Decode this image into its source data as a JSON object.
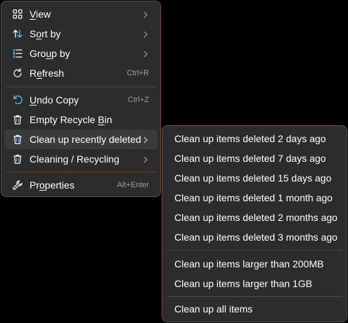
{
  "main_menu": {
    "items": [
      {
        "label": "View",
        "accel_index": 0,
        "shortcut": "",
        "submenu": true,
        "icon": "grid-view-icon"
      },
      {
        "label": "Sort by",
        "accel_index": 1,
        "shortcut": "",
        "submenu": true,
        "icon": "sort-arrows-icon"
      },
      {
        "label": "Group by",
        "accel_index": 3,
        "shortcut": "",
        "submenu": true,
        "icon": "group-list-icon"
      },
      {
        "label": "Refresh",
        "accel_index": 1,
        "shortcut": "Ctrl+R",
        "submenu": false,
        "icon": "refresh-icon"
      },
      {
        "label": "Undo Copy",
        "accel_index": 0,
        "shortcut": "Ctrl+Z",
        "submenu": false,
        "icon": "undo-icon"
      },
      {
        "label": "Empty Recycle Bin",
        "accel_index": 14,
        "shortcut": "",
        "submenu": false,
        "icon": "recycle-bin-icon"
      },
      {
        "label": "Clean up recently deleted",
        "accel_index": -1,
        "shortcut": "",
        "submenu": true,
        "icon": "recycle-bin-icon",
        "highlighted": true
      },
      {
        "label": "Cleaning / Recycling",
        "accel_index": -1,
        "shortcut": "",
        "submenu": true,
        "icon": "recycle-bin-icon"
      },
      {
        "label": "Properties",
        "accel_index": 2,
        "shortcut": "Alt+Enter",
        "submenu": false,
        "icon": "wrench-icon"
      }
    ]
  },
  "sub_menu": {
    "items": [
      {
        "label": "Clean up items deleted 2 days ago"
      },
      {
        "label": "Clean up items deleted 7 days ago"
      },
      {
        "label": "Clean up items deleted 15 days ago"
      },
      {
        "label": "Clean up items deleted 1 month ago"
      },
      {
        "label": "Clean up items deleted 2 months ago"
      },
      {
        "label": "Clean up items deleted 3 months ago"
      },
      {
        "label": "Clean up items larger than 200MB"
      },
      {
        "label": "Clean up items larger than 1GB"
      },
      {
        "label": "Clean up all items"
      }
    ]
  },
  "colors": {
    "menu_bg": "#2c2c2c",
    "border": "#6e4a3f",
    "hover": "#3a3a3a",
    "icon_blue": "#4cc2ff",
    "icon_white": "#ffffff",
    "shortcut_text": "#9d9d9d"
  }
}
